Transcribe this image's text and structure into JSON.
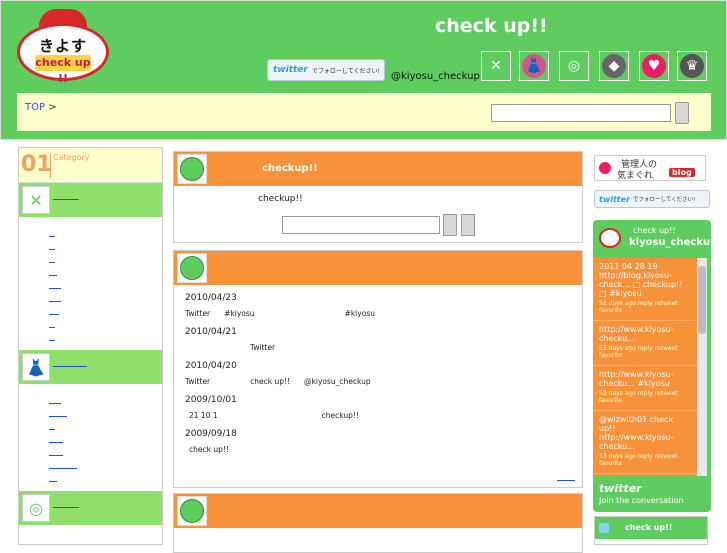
{
  "header": {
    "logo_name": "きよす",
    "logo_sub": "check up !!",
    "site_title": "check up!!",
    "follow_word": "twitter",
    "follow_msg": "でフォローしてください!",
    "handle": "@kiyosu_checkup",
    "icons": [
      {
        "name": "fork-knife-icon",
        "glyph": "✕",
        "color": "#5fcc5f"
      },
      {
        "name": "fashion-photo-icon",
        "glyph": "👗",
        "color": "#c85a8a"
      },
      {
        "name": "ball-icon",
        "glyph": "◎",
        "color": "#5fcc5f"
      },
      {
        "name": "diamond-icon",
        "glyph": "◆",
        "color": "#666666"
      },
      {
        "name": "heart-icon",
        "glyph": "♥",
        "color": "#e91e63"
      },
      {
        "name": "shirt-icon",
        "glyph": "♛",
        "color": "#555555"
      }
    ]
  },
  "breadcrumb": {
    "top": "TOP",
    "sep": ">"
  },
  "sidebar": {
    "cat_num": "01",
    "cat_label": "Category"
  },
  "main": {
    "panel1": {
      "title": "checkup!!",
      "desc": "checkup!!"
    },
    "panel2": {
      "entries": [
        {
          "date": "2010/04/23",
          "parts": [
            "Twitter",
            "#kiyosu",
            "#kiyosu"
          ]
        },
        {
          "date": "2010/04/21",
          "parts": [
            "Twitter"
          ]
        },
        {
          "date": "2010/04/20",
          "parts": [
            "Twitter",
            "check up!!",
            "@kiyosu_checkup"
          ]
        },
        {
          "date": "2009/10/01",
          "parts": [
            "21 10 1",
            "checkup!!"
          ]
        },
        {
          "date": "2009/09/18",
          "parts": [
            "check up!!"
          ]
        }
      ]
    }
  },
  "right": {
    "blog_title": "管理人の",
    "blog_sub": "気まぐれ",
    "blog_tag": "blog",
    "follow_word": "twitter",
    "follow_msg": "でフォローしてください!",
    "widget": {
      "name1": "check up!!",
      "name2": "kiyosu_checkup",
      "tweets": [
        {
          "text": "2011 04 28 19 http://blog.kiyosu-check... □ checkup!! □ #kiyosu",
          "meta": "51 days ago  reply  retweet  favorite"
        },
        {
          "text": "http://www.kiyosu-checku...",
          "meta": "53 days ago  reply  retweet  favorite"
        },
        {
          "text": "http://www.kiyosu-checku... #kiyosu",
          "meta": "53 days ago  reply  retweet  favorite"
        },
        {
          "text": "@wizwith01 check up!! http://www.kiyosu-checku...",
          "meta": "53 days ago  reply  retweet  favorite"
        }
      ],
      "brand": "twitter",
      "join": "Join the conversation"
    },
    "mini_title": "check up!!"
  }
}
